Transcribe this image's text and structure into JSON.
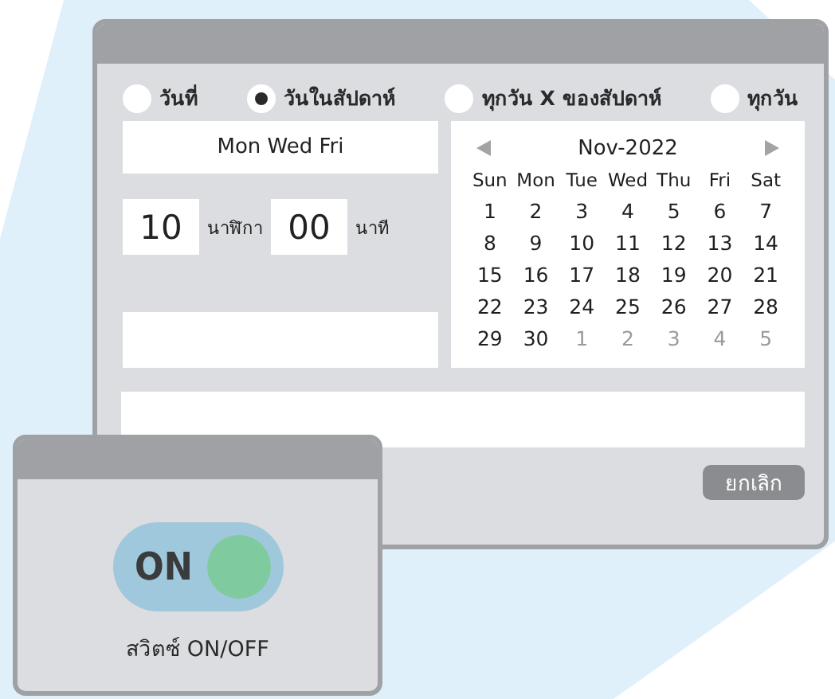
{
  "schedule_window": {
    "radio_options": [
      {
        "label": "วันที่",
        "selected": false
      },
      {
        "label": "วันในสัปดาห์",
        "selected": true
      },
      {
        "label": "ทุกวัน X ของสัปดาห์",
        "selected": false
      },
      {
        "label": "ทุกวัน",
        "selected": false
      }
    ],
    "weekday_field": {
      "value": "Mon Wed Fri"
    },
    "time": {
      "hour": "10",
      "hour_unit": "นาฬิกา",
      "minute": "00",
      "minute_unit": "นาที"
    },
    "calendar": {
      "month": "Nov-2022",
      "weekdays": [
        "Sun",
        "Mon",
        "Tue",
        "Wed",
        "Thu",
        "Fri",
        "Sat"
      ],
      "days": [
        {
          "label": "1",
          "outside": false
        },
        {
          "label": "2",
          "outside": false
        },
        {
          "label": "3",
          "outside": false
        },
        {
          "label": "4",
          "outside": false
        },
        {
          "label": "5",
          "outside": false
        },
        {
          "label": "6",
          "outside": false
        },
        {
          "label": "7",
          "outside": false
        },
        {
          "label": "8",
          "outside": false
        },
        {
          "label": "9",
          "outside": false
        },
        {
          "label": "10",
          "outside": false
        },
        {
          "label": "11",
          "outside": false
        },
        {
          "label": "12",
          "outside": false
        },
        {
          "label": "13",
          "outside": false
        },
        {
          "label": "14",
          "outside": false
        },
        {
          "label": "15",
          "outside": false
        },
        {
          "label": "16",
          "outside": false
        },
        {
          "label": "17",
          "outside": false
        },
        {
          "label": "18",
          "outside": false
        },
        {
          "label": "19",
          "outside": false
        },
        {
          "label": "20",
          "outside": false
        },
        {
          "label": "21",
          "outside": false
        },
        {
          "label": "22",
          "outside": false
        },
        {
          "label": "23",
          "outside": false
        },
        {
          "label": "24",
          "outside": false
        },
        {
          "label": "25",
          "outside": false
        },
        {
          "label": "26",
          "outside": false
        },
        {
          "label": "27",
          "outside": false
        },
        {
          "label": "28",
          "outside": false
        },
        {
          "label": "29",
          "outside": false
        },
        {
          "label": "30",
          "outside": false
        },
        {
          "label": "1",
          "outside": true
        },
        {
          "label": "2",
          "outside": true
        },
        {
          "label": "3",
          "outside": true
        },
        {
          "label": "4",
          "outside": true
        },
        {
          "label": "5",
          "outside": true
        }
      ]
    },
    "cancel_button": "ยกเลิก"
  },
  "switch_window": {
    "toggle": {
      "label": "ON",
      "on": true
    },
    "caption": "สวิตซ์ ON/OFF"
  }
}
